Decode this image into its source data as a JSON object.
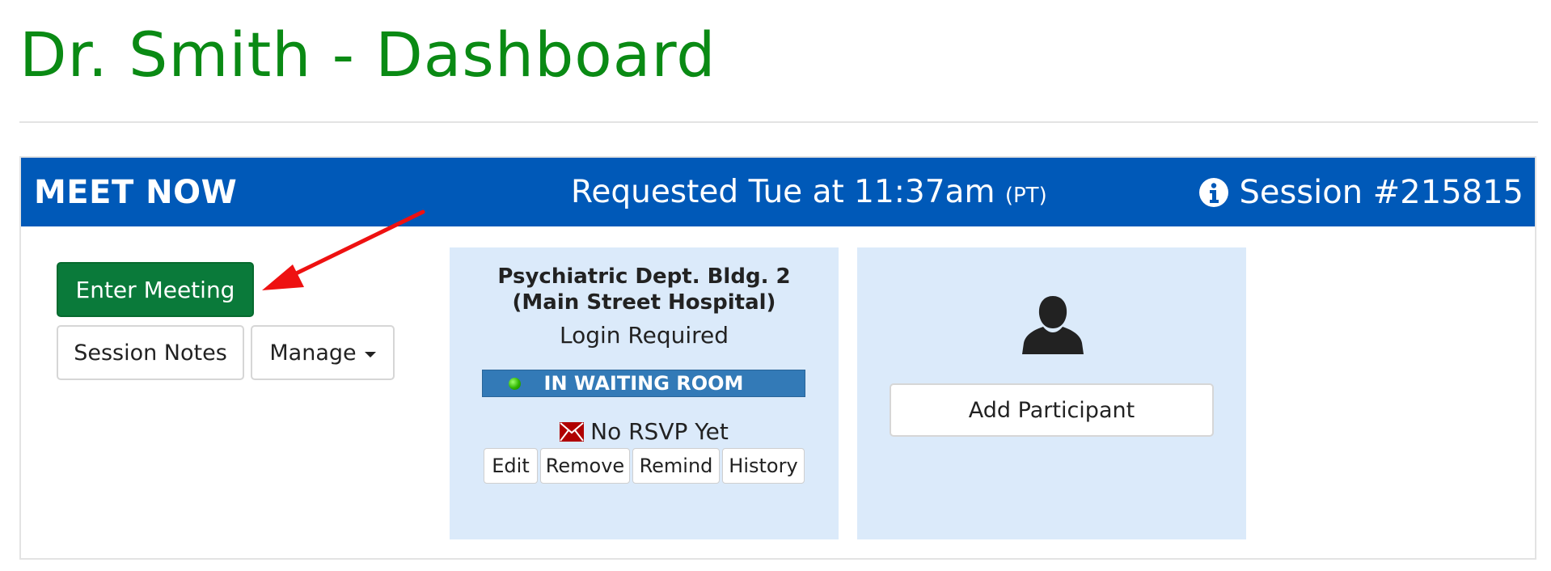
{
  "page": {
    "title": "Dr. Smith - Dashboard"
  },
  "meeting": {
    "header": {
      "left_label": "MEET NOW",
      "requested_text": "Requested Tue at 11:37am",
      "timezone": "(PT)",
      "session_label": "Session #215815",
      "info_icon": "info-circle-icon"
    },
    "actions": {
      "enter_label": "Enter Meeting",
      "notes_label": "Session Notes",
      "manage_label": "Manage"
    },
    "participant": {
      "location": "Psychiatric Dept. Bldg. 2 (Main Street Hospital)",
      "login": "Login Required",
      "status": "IN WAITING ROOM",
      "rsvp": "No RSVP Yet",
      "buttons": {
        "edit": "Edit",
        "remove": "Remove",
        "remind": "Remind",
        "history": "History"
      }
    },
    "add_participant": {
      "label": "Add Participant",
      "icon": "user-silhouette-icon"
    }
  },
  "colors": {
    "title_green": "#0a8a14",
    "header_blue": "#0059b8",
    "enter_green": "#0a7a3a",
    "card_bg": "#dbeafa",
    "status_blue": "#337ab7",
    "arrow_red": "#ee1111",
    "mail_red": "#b00000"
  }
}
